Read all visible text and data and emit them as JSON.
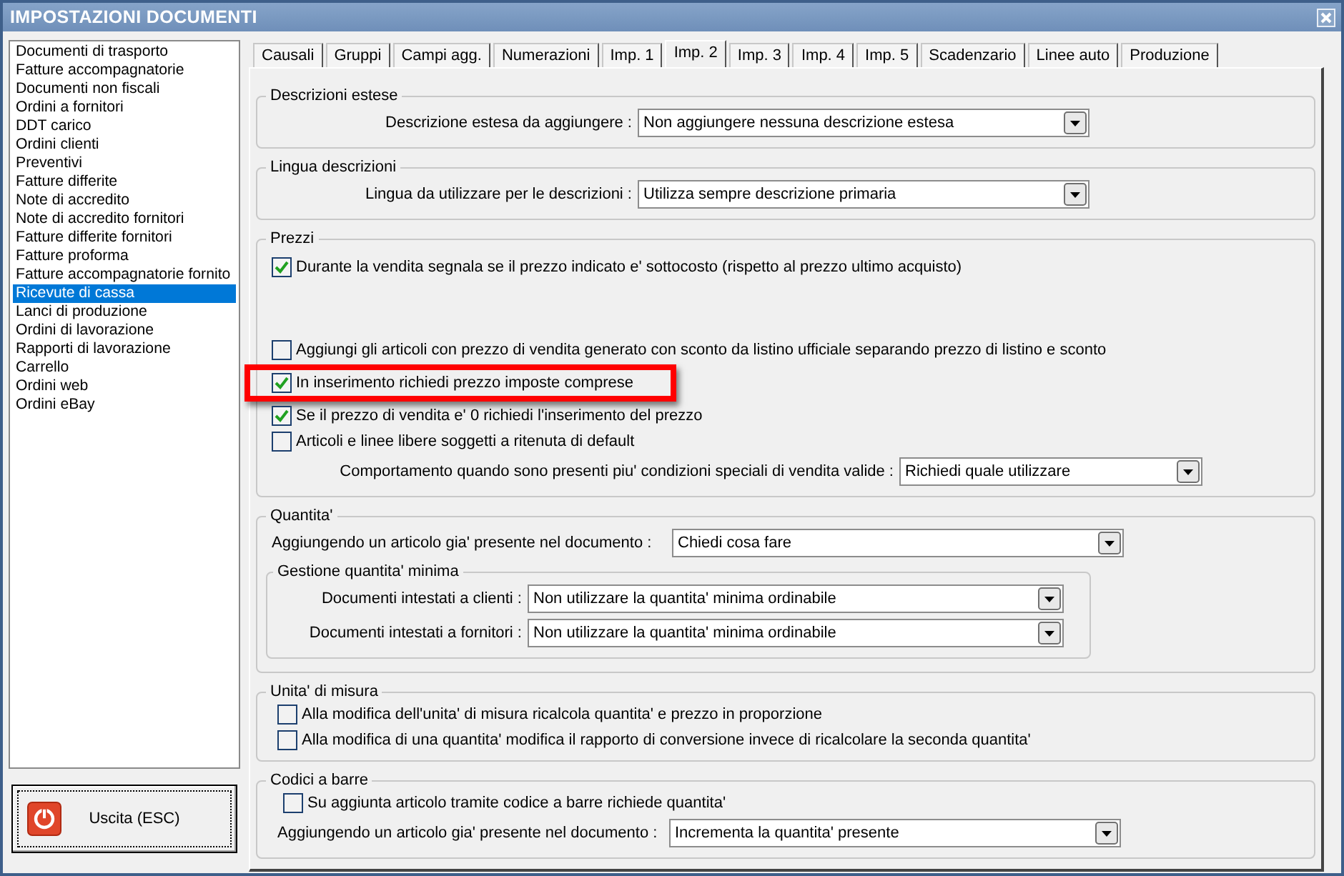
{
  "window": {
    "title": "IMPOSTAZIONI DOCUMENTI"
  },
  "sidebar": {
    "items": [
      {
        "label": "Documenti di trasporto",
        "selected": false
      },
      {
        "label": "Fatture accompagnatorie",
        "selected": false
      },
      {
        "label": "Documenti non fiscali",
        "selected": false
      },
      {
        "label": "Ordini a fornitori",
        "selected": false
      },
      {
        "label": "DDT carico",
        "selected": false
      },
      {
        "label": "Ordini clienti",
        "selected": false
      },
      {
        "label": "Preventivi",
        "selected": false
      },
      {
        "label": "Fatture differite",
        "selected": false
      },
      {
        "label": "Note di accredito",
        "selected": false
      },
      {
        "label": "Note di accredito fornitori",
        "selected": false
      },
      {
        "label": "Fatture differite fornitori",
        "selected": false
      },
      {
        "label": "Fatture proforma",
        "selected": false
      },
      {
        "label": "Fatture accompagnatorie fornito",
        "selected": false
      },
      {
        "label": "Ricevute di cassa",
        "selected": true
      },
      {
        "label": "Lanci di produzione",
        "selected": false
      },
      {
        "label": "Ordini di lavorazione",
        "selected": false
      },
      {
        "label": "Rapporti di lavorazione",
        "selected": false
      },
      {
        "label": "Carrello",
        "selected": false
      },
      {
        "label": "Ordini web",
        "selected": false
      },
      {
        "label": "Ordini eBay",
        "selected": false
      }
    ]
  },
  "exit_button": {
    "label": "Uscita (ESC)"
  },
  "tabs": [
    {
      "label": "Causali",
      "selected": false
    },
    {
      "label": "Gruppi",
      "selected": false
    },
    {
      "label": "Campi agg.",
      "selected": false
    },
    {
      "label": "Numerazioni",
      "selected": false
    },
    {
      "label": "Imp. 1",
      "selected": false
    },
    {
      "label": "Imp. 2",
      "selected": true
    },
    {
      "label": "Imp. 3",
      "selected": false
    },
    {
      "label": "Imp. 4",
      "selected": false
    },
    {
      "label": "Imp. 5",
      "selected": false
    },
    {
      "label": "Scadenzario",
      "selected": false
    },
    {
      "label": "Linee auto",
      "selected": false
    },
    {
      "label": "Produzione",
      "selected": false
    }
  ],
  "groups": [
    {
      "title": "Descrizioni estese",
      "rows": [
        {
          "kind": "select",
          "label": "Descrizione estesa da aggiungere :",
          "value": "Non aggiungere nessuna descrizione estesa"
        }
      ]
    },
    {
      "title": "Lingua descrizioni",
      "rows": [
        {
          "kind": "select",
          "label": "Lingua da utilizzare per le descrizioni :",
          "value": "Utilizza sempre descrizione primaria"
        }
      ]
    },
    {
      "title": "Prezzi",
      "rows": [
        {
          "kind": "checkbox",
          "label": "Durante la vendita segnala se il prezzo indicato e' sottocosto (rispetto al prezzo ultimo acquisto)",
          "checked": true,
          "highlighted": false
        },
        {
          "kind": "checkbox",
          "label": "Aggiungi gli articoli con prezzo di vendita generato con sconto da listino ufficiale separando prezzo di listino e sconto",
          "checked": false,
          "highlighted": false
        },
        {
          "kind": "checkbox",
          "label": "In inserimento richiedi prezzo imposte comprese",
          "checked": true,
          "highlighted": true
        },
        {
          "kind": "checkbox",
          "label": "Se il prezzo di vendita e' 0 richiedi l'inserimento del prezzo",
          "checked": true,
          "highlighted": false
        },
        {
          "kind": "checkbox",
          "label": "Articoli e linee libere soggetti a ritenuta di default",
          "checked": false,
          "highlighted": false
        },
        {
          "kind": "select",
          "label": "Comportamento quando sono presenti piu' condizioni speciali di vendita valide :",
          "value": "Richiedi quale utilizzare"
        }
      ]
    },
    {
      "title": "Quantita'",
      "rows": [
        {
          "kind": "select",
          "label": "Aggiungendo un articolo gia' presente nel documento :",
          "value": "Chiedi cosa fare"
        },
        {
          "kind": "group",
          "title": "Gestione quantita' minima",
          "rows": [
            {
              "kind": "select",
              "label": "Documenti intestati a clienti :",
              "value": "Non utilizzare la quantita' minima ordinabile"
            },
            {
              "kind": "select",
              "label": "Documenti intestati a fornitori :",
              "value": "Non utilizzare la quantita' minima ordinabile"
            }
          ]
        }
      ]
    },
    {
      "title": "Unita' di misura",
      "rows": [
        {
          "kind": "checkbox",
          "label": "Alla modifica dell'unita' di misura ricalcola quantita' e prezzo in proporzione",
          "checked": false
        },
        {
          "kind": "checkbox",
          "label": "Alla modifica di una quantita' modifica il rapporto di conversione invece di ricalcolare la seconda quantita'",
          "checked": false
        }
      ]
    },
    {
      "title": "Codici a barre",
      "rows": [
        {
          "kind": "checkbox",
          "label": "Su aggiunta articolo tramite codice a barre richiede quantita'",
          "checked": false
        },
        {
          "kind": "select",
          "label": "Aggiungendo un articolo gia' presente nel documento :",
          "value": "Incrementa la quantita' presente"
        }
      ]
    }
  ]
}
